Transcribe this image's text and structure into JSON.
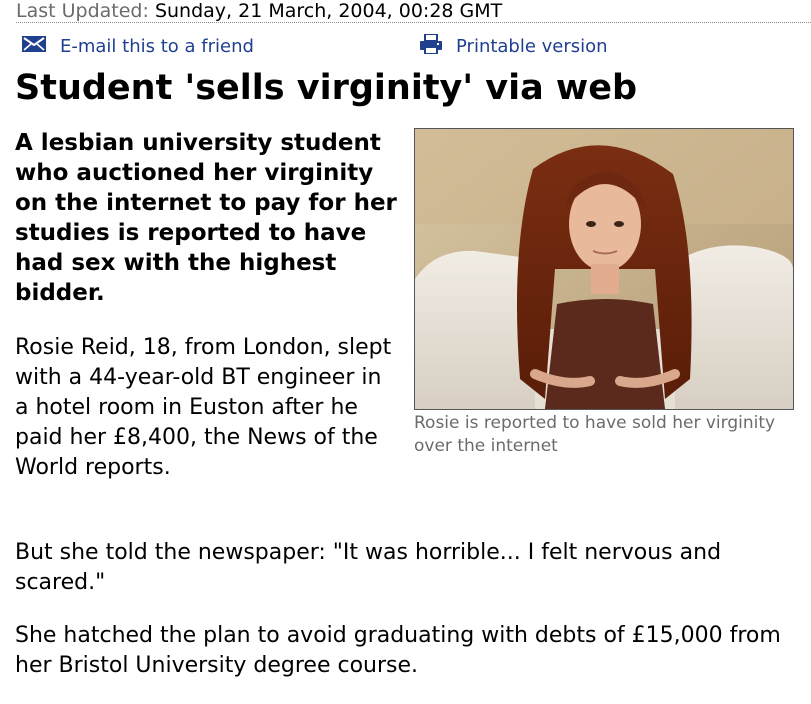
{
  "meta": {
    "updated_label": "Last Updated:",
    "updated_value": "Sunday, 21 March, 2004, 00:28 GMT"
  },
  "tools": {
    "email_label": "E-mail this to a friend",
    "email_icon": "envelope-icon",
    "print_label": "Printable version",
    "print_icon": "printer-icon",
    "link_color": "#1f3f8f"
  },
  "article": {
    "headline": "Student 'sells virginity' via web",
    "intro": "A lesbian university student who auctioned her virginity on the internet to pay for her studies is reported to have had sex with the highest bidder.",
    "paragraphs": [
      "Rosie Reid, 18, from London, slept with a 44-year-old BT engineer in a hotel room in Euston after he paid her £8,400, the News of the World reports.",
      "But she told the newspaper: \"It was horrible... I felt nervous and scared.\"",
      "She hatched the plan to avoid graduating with debts of £15,000 from her Bristol University degree course."
    ]
  },
  "photo": {
    "caption": "Rosie is reported to have sold her virginity over the internet"
  }
}
